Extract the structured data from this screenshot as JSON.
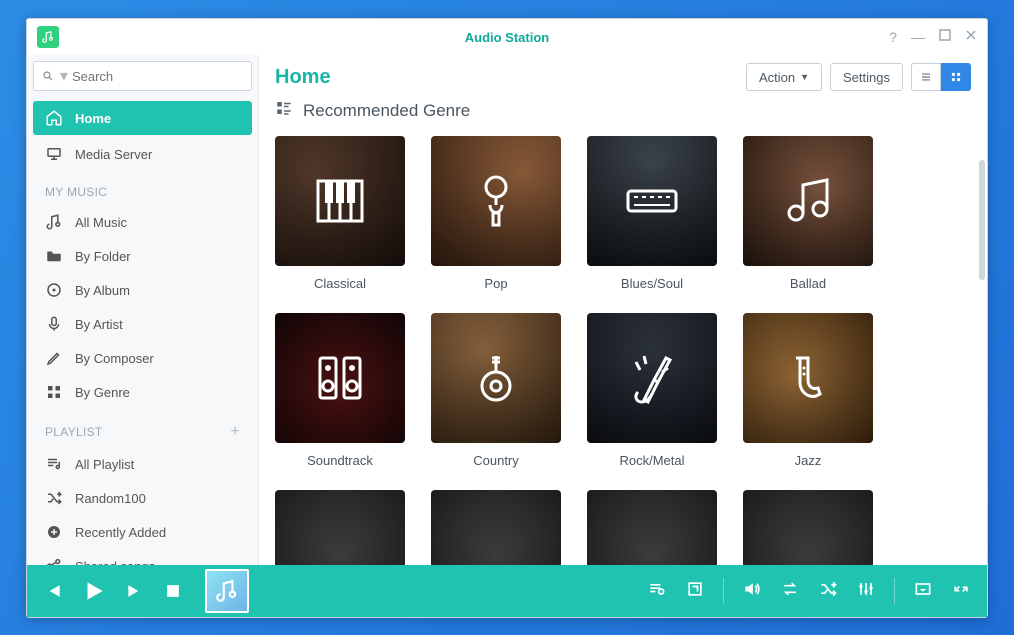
{
  "window": {
    "title": "Audio Station"
  },
  "search": {
    "placeholder": "Search"
  },
  "sidebar": {
    "top": [
      {
        "label": "Home",
        "icon": "home",
        "active": true
      },
      {
        "label": "Media Server",
        "icon": "mediaserver"
      }
    ],
    "sections": [
      {
        "title": "MY MUSIC",
        "items": [
          {
            "label": "All Music",
            "icon": "music-note"
          },
          {
            "label": "By Folder",
            "icon": "folder"
          },
          {
            "label": "By Album",
            "icon": "disc"
          },
          {
            "label": "By Artist",
            "icon": "mic"
          },
          {
            "label": "By Composer",
            "icon": "pen"
          },
          {
            "label": "By Genre",
            "icon": "grid"
          }
        ]
      },
      {
        "title": "PLAYLIST",
        "add": true,
        "items": [
          {
            "label": "All Playlist",
            "icon": "playlist"
          },
          {
            "label": "Random100",
            "icon": "shuffle"
          },
          {
            "label": "Recently Added",
            "icon": "plus-circle"
          },
          {
            "label": "Shared songs",
            "icon": "share"
          }
        ]
      }
    ]
  },
  "main": {
    "title": "Home",
    "actionLabel": "Action",
    "settingsLabel": "Settings",
    "subheading": "Recommended Genre",
    "tiles": [
      {
        "label": "Classical",
        "cls": "classical",
        "icon": "piano"
      },
      {
        "label": "Pop",
        "cls": "pop",
        "icon": "microphone"
      },
      {
        "label": "Blues/Soul",
        "cls": "blues",
        "icon": "keyboard"
      },
      {
        "label": "Ballad",
        "cls": "ballad",
        "icon": "notes"
      },
      {
        "label": "Soundtrack",
        "cls": "soundtrack",
        "icon": "speakers"
      },
      {
        "label": "Country",
        "cls": "country",
        "icon": "guitar"
      },
      {
        "label": "Rock/Metal",
        "cls": "rock",
        "icon": "rockguitar"
      },
      {
        "label": "Jazz",
        "cls": "jazz",
        "icon": "sax"
      },
      {
        "label": "",
        "cls": "generic",
        "icon": ""
      },
      {
        "label": "",
        "cls": "generic",
        "icon": ""
      },
      {
        "label": "",
        "cls": "generic",
        "icon": ""
      },
      {
        "label": "",
        "cls": "generic",
        "icon": ""
      }
    ]
  }
}
